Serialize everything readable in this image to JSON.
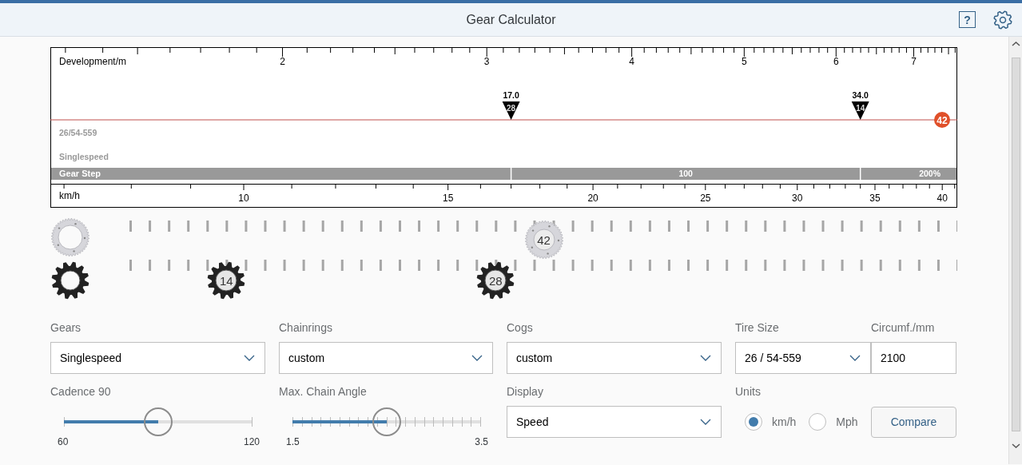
{
  "header": {
    "title": "Gear Calculator",
    "help": "?"
  },
  "chart": {
    "top_axis": {
      "label": "Development/m",
      "ticks": [
        "2",
        "3",
        "4",
        "5",
        "6",
        "7"
      ]
    },
    "bottom_axis": {
      "label": "km/h",
      "ticks": [
        "10",
        "15",
        "20",
        "25",
        "30",
        "35",
        "40"
      ]
    },
    "tire_label": "26/54-559",
    "gears_label": "Singlespeed",
    "chainring": "42",
    "markers": [
      {
        "speed": "17.0",
        "cog": "28"
      },
      {
        "speed": "34.0",
        "cog": "14"
      }
    ],
    "gear_step": {
      "label": "Gear Step",
      "segments": [
        "100",
        "200%"
      ]
    }
  },
  "drivetrain": {
    "chainrings": [
      {
        "teeth": "42"
      }
    ],
    "cogs": [
      {
        "teeth": "14"
      },
      {
        "teeth": "28"
      }
    ]
  },
  "form": [
    {
      "kind": "select",
      "label": "Gears",
      "value": "Singlespeed"
    },
    {
      "kind": "select",
      "label": "Chainrings",
      "value": "custom"
    },
    {
      "kind": "select",
      "label": "Cogs",
      "value": "custom"
    },
    {
      "kind": "select",
      "label": "Tire Size",
      "value": "26 / 54-559"
    },
    {
      "kind": "input",
      "label": "Circumf./mm",
      "value": "2100"
    },
    {
      "kind": "slider",
      "label": "Cadence 90",
      "level": 0.5,
      "min": "60",
      "max": "120",
      "ticks": false
    },
    {
      "kind": "slider",
      "label": "Max. Chain Angle",
      "level": 0.5,
      "min": "1.5",
      "max": "3.5",
      "ticks": true
    },
    {
      "kind": "select",
      "label": "Display",
      "value": "Speed"
    },
    {
      "kind": "radios",
      "label": "Units",
      "options": [
        {
          "label": "km/h",
          "selected": true
        },
        {
          "label": "Mph",
          "selected": false
        }
      ]
    },
    {
      "kind": "button",
      "label": "Compare"
    }
  ]
}
